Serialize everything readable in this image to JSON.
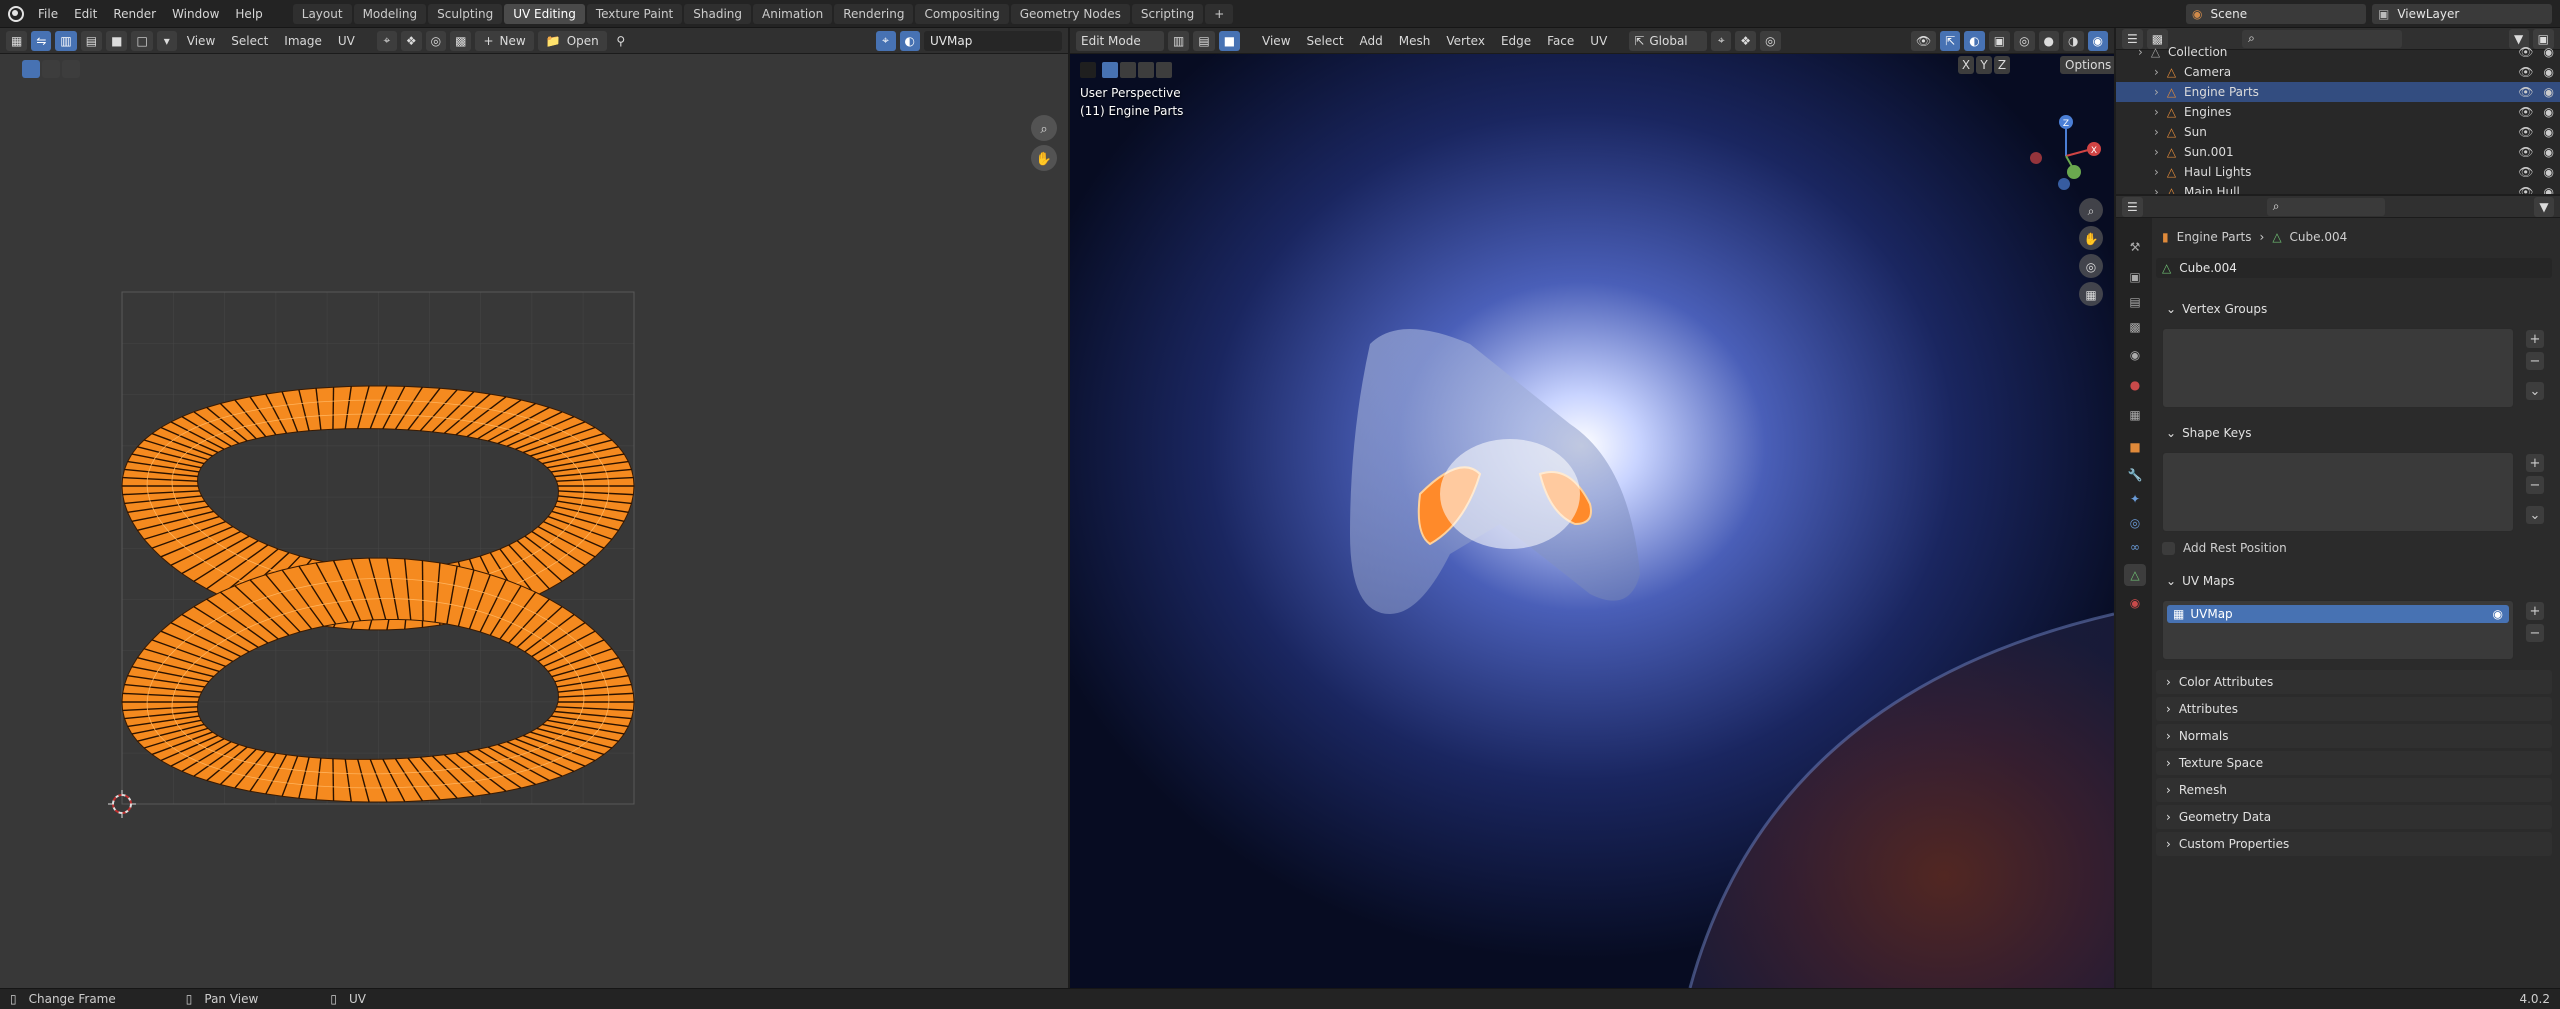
{
  "topbar": {
    "menus": [
      "File",
      "Edit",
      "Render",
      "Window",
      "Help"
    ],
    "workspaces": [
      "Layout",
      "Modeling",
      "Sculpting",
      "UV Editing",
      "Texture Paint",
      "Shading",
      "Animation",
      "Rendering",
      "Compositing",
      "Geometry Nodes",
      "Scripting"
    ],
    "active_workspace": "UV Editing",
    "add_tab": "+",
    "scene": "Scene",
    "view_layer": "ViewLayer"
  },
  "uv_editor": {
    "menus": [
      "View",
      "Select",
      "Image",
      "UV"
    ],
    "new_label": "New",
    "open_label": "Open",
    "uv_map": "UVMap"
  },
  "viewport": {
    "mode": "Edit Mode",
    "menus": [
      "View",
      "Select",
      "Add",
      "Mesh",
      "Vertex",
      "Edge",
      "Face",
      "UV"
    ],
    "transform": "Global",
    "perspective_label": "User Perspective",
    "object_label": "(11) Engine Parts",
    "axes": [
      "X",
      "Y",
      "Z"
    ],
    "options_label": "Options"
  },
  "outliner": {
    "items": [
      {
        "label": "Collection",
        "selected": false
      },
      {
        "label": "Camera",
        "selected": false
      },
      {
        "label": "Engine Parts",
        "selected": true
      },
      {
        "label": "Engines",
        "selected": false
      },
      {
        "label": "Sun",
        "selected": false
      },
      {
        "label": "Sun.001",
        "selected": false
      },
      {
        "label": "Haul Lights",
        "selected": false
      },
      {
        "label": "Main Hull",
        "selected": false
      }
    ]
  },
  "properties": {
    "breadcrumb_object": "Engine Parts",
    "breadcrumb_data": "Cube.004",
    "mesh_name": "Cube.004",
    "panels": {
      "vertex_groups": "Vertex Groups",
      "shape_keys": "Shape Keys",
      "add_rest_position": "Add Rest Position",
      "uv_maps": "UV Maps",
      "uv_map_item": "UVMap",
      "color_attributes": "Color Attributes",
      "attributes": "Attributes",
      "normals": "Normals",
      "texture_space": "Texture Space",
      "remesh": "Remesh",
      "geometry_data": "Geometry Data",
      "custom_properties": "Custom Properties"
    }
  },
  "statusbar": {
    "left": "Change Frame",
    "middle": "Pan View",
    "right_hint": "UV",
    "version": "4.0.2"
  },
  "colors": {
    "accent": "#4772b3",
    "uv_orange": "#f58a1f",
    "selection": "#334d80"
  }
}
